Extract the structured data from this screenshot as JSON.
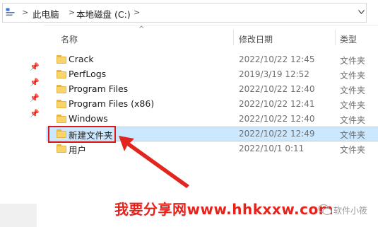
{
  "address_bar": {
    "crumbs": [
      "此电脑",
      "本地磁盘 (C:)"
    ],
    "separator": ">"
  },
  "columns": {
    "name": "名称",
    "modified": "修改日期",
    "type": "类型"
  },
  "rows": [
    {
      "name": "Crack",
      "modified": "2022/10/22 12:45",
      "type": "文件夹"
    },
    {
      "name": "PerfLogs",
      "modified": "2019/3/19 12:52",
      "type": "文件夹"
    },
    {
      "name": "Program Files",
      "modified": "2022/10/22 12:40",
      "type": "文件夹"
    },
    {
      "name": "Program Files (x86)",
      "modified": "2022/10/22 12:41",
      "type": "文件夹"
    },
    {
      "name": "Windows",
      "modified": "2022/10/22 12:40",
      "type": "文件夹"
    },
    {
      "name": "新建文件夹",
      "modified": "2022/10/22 12:49",
      "type": "文件夹",
      "selected": true
    },
    {
      "name": "用户",
      "modified": "2022/10/1 0:11",
      "type": "文件夹"
    }
  ],
  "watermark": "我要分享网www.hhkxxw.com",
  "wechat_label": "软件小筱",
  "colors": {
    "selection_bg": "#cce8ff",
    "selection_border": "#99d1ff",
    "annotation_red": "#d91a1a",
    "folder_yellow": "#fbd36b"
  },
  "icons": {
    "nav_up": "computer-path-icon",
    "pin": "pin-icon",
    "folder": "folder-icon",
    "dropdown": "chevron-down-icon",
    "arrow": "annotation-arrow"
  }
}
